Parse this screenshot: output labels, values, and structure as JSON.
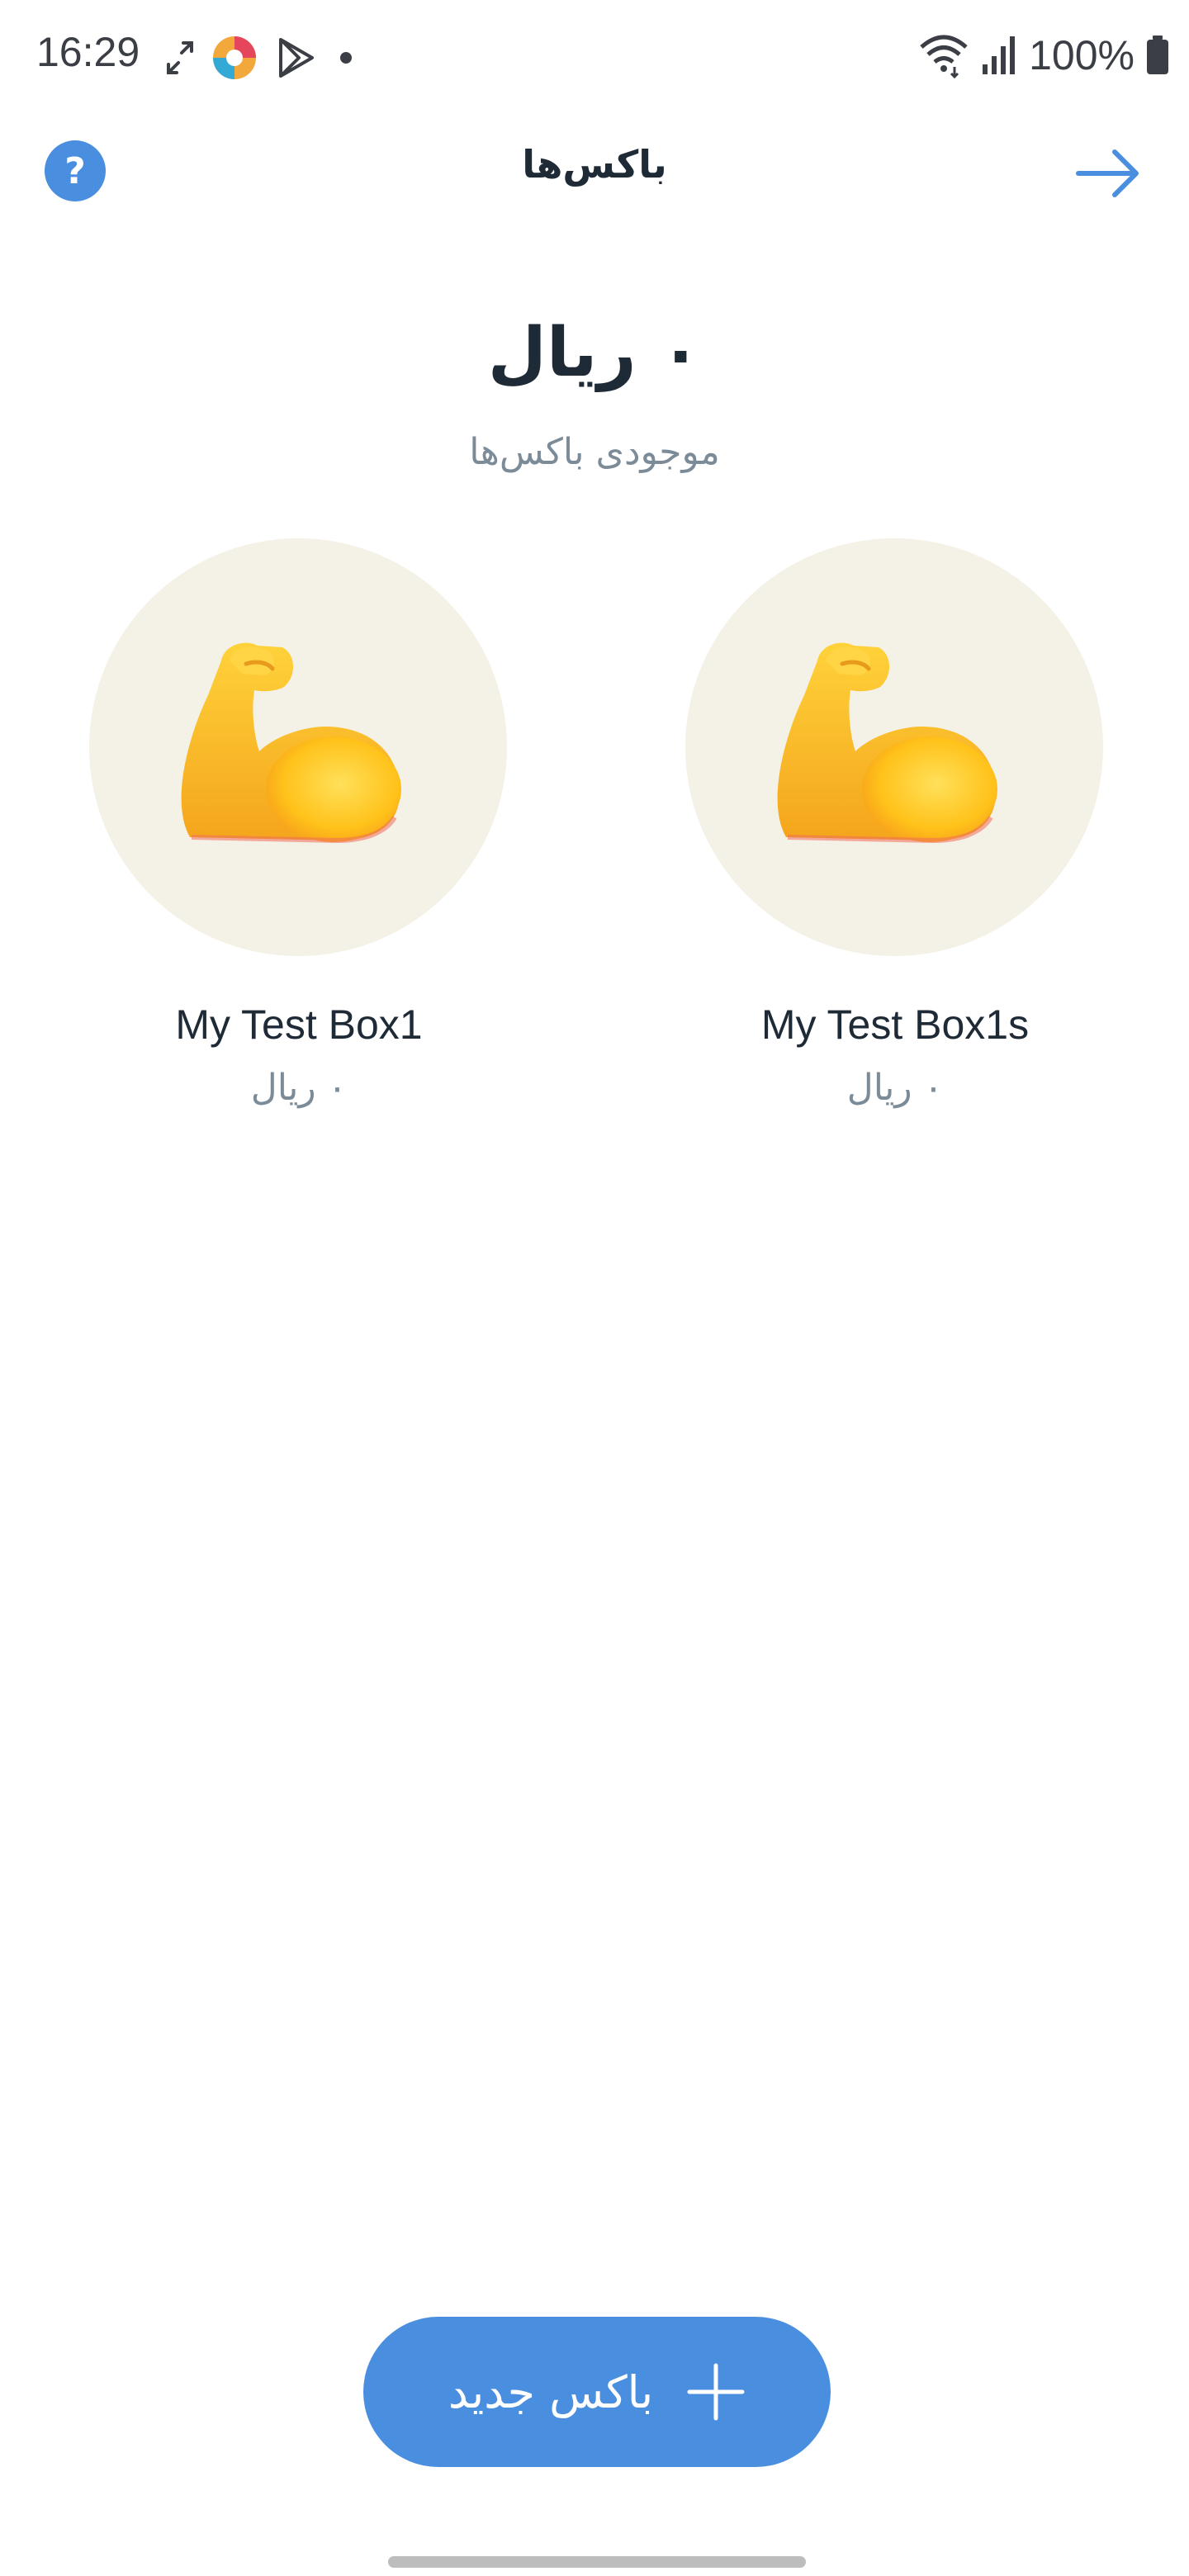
{
  "status_bar": {
    "time": "16:29",
    "battery": "100%"
  },
  "header": {
    "title": "باکس‌ها",
    "help_symbol": "?"
  },
  "summary": {
    "balance": "۰ ریال",
    "label": "موجودی باکس‌ها"
  },
  "boxes": [
    {
      "name": "My Test Box1",
      "balance": "۰ ریال",
      "icon": "flexed-biceps-emoji"
    },
    {
      "name": "My Test Box1s",
      "balance": "۰ ریال",
      "icon": "flexed-biceps-emoji"
    }
  ],
  "fab": {
    "label": "باکس جدید"
  },
  "colors": {
    "accent": "#4a8ee0",
    "circle_bg": "#f4f1e6",
    "muted_text": "#7c8b98"
  }
}
